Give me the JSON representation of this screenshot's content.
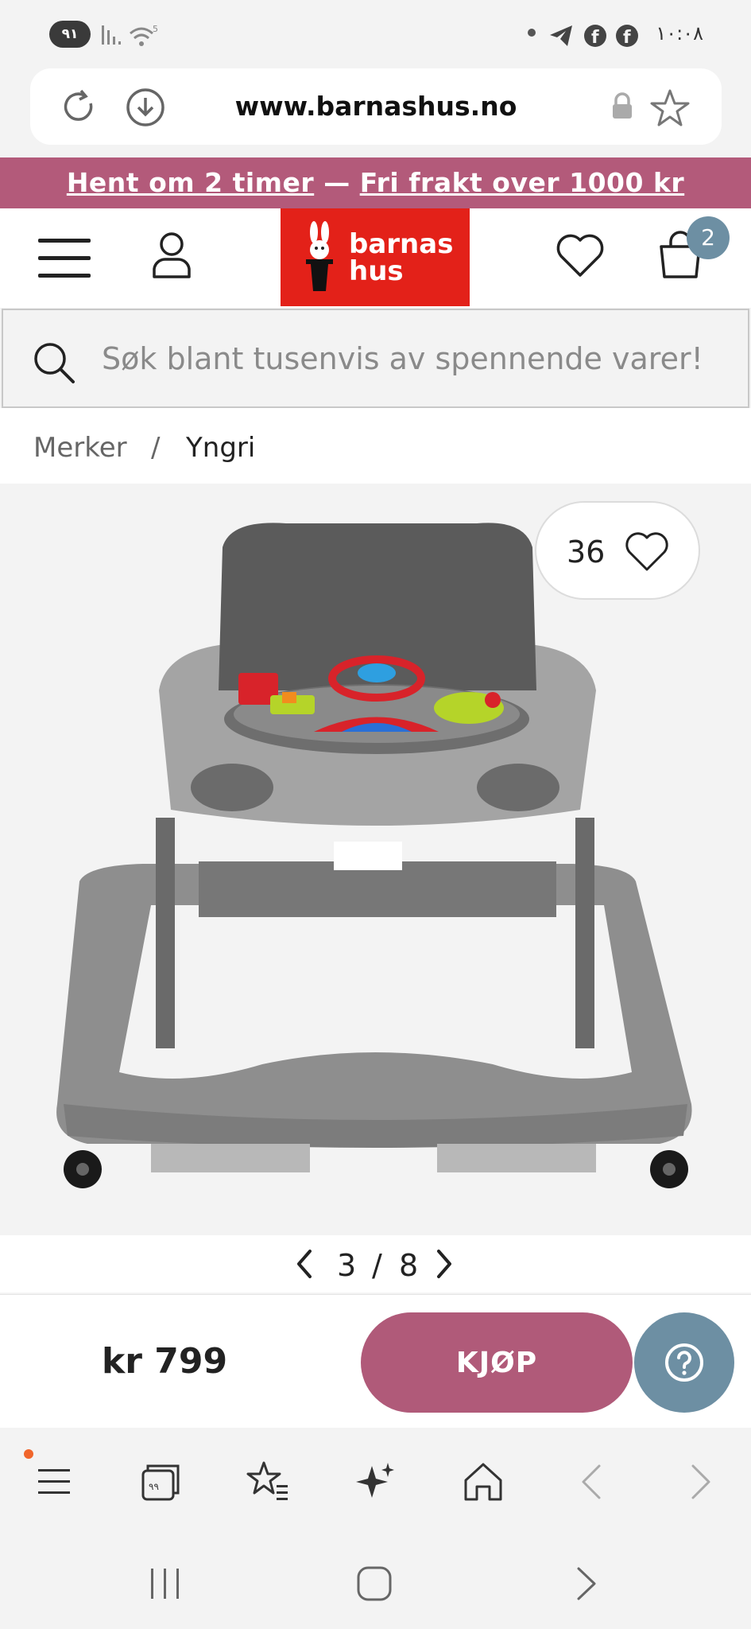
{
  "status_bar": {
    "battery": "٩١",
    "time": "١٠:٠٨",
    "wifi_badge": "5"
  },
  "browser": {
    "url": "www.barnashus.no"
  },
  "promo": {
    "part1": "Hent om 2 timer",
    "separator": " — ",
    "part2": "Fri frakt over 1000 kr"
  },
  "header": {
    "logo_line1": "barnas",
    "logo_line2": "hus",
    "cart_count": "2"
  },
  "search": {
    "placeholder": "Søk blant tusenvis av spennende varer!"
  },
  "breadcrumb": {
    "items": [
      "Merker",
      "Yngri"
    ],
    "separator": "/"
  },
  "product": {
    "likes": "36",
    "image_index": "3",
    "image_total": "8",
    "pager_separator": "/"
  },
  "buy_bar": {
    "price": "kr 799",
    "buy_label": "KJØP"
  },
  "colors": {
    "promo": "#b35a7a",
    "logo": "#e32119",
    "buy": "#b05a79",
    "help": "#6d8fa3",
    "cart_badge": "#6d8fa3",
    "tab_dot": "#f0652b"
  },
  "icons": {
    "browser_nav": [
      "menu-icon",
      "tabs-icon",
      "bookmarks-icon",
      "ai-sparkle-icon",
      "home-icon",
      "back-icon",
      "forward-icon"
    ]
  }
}
